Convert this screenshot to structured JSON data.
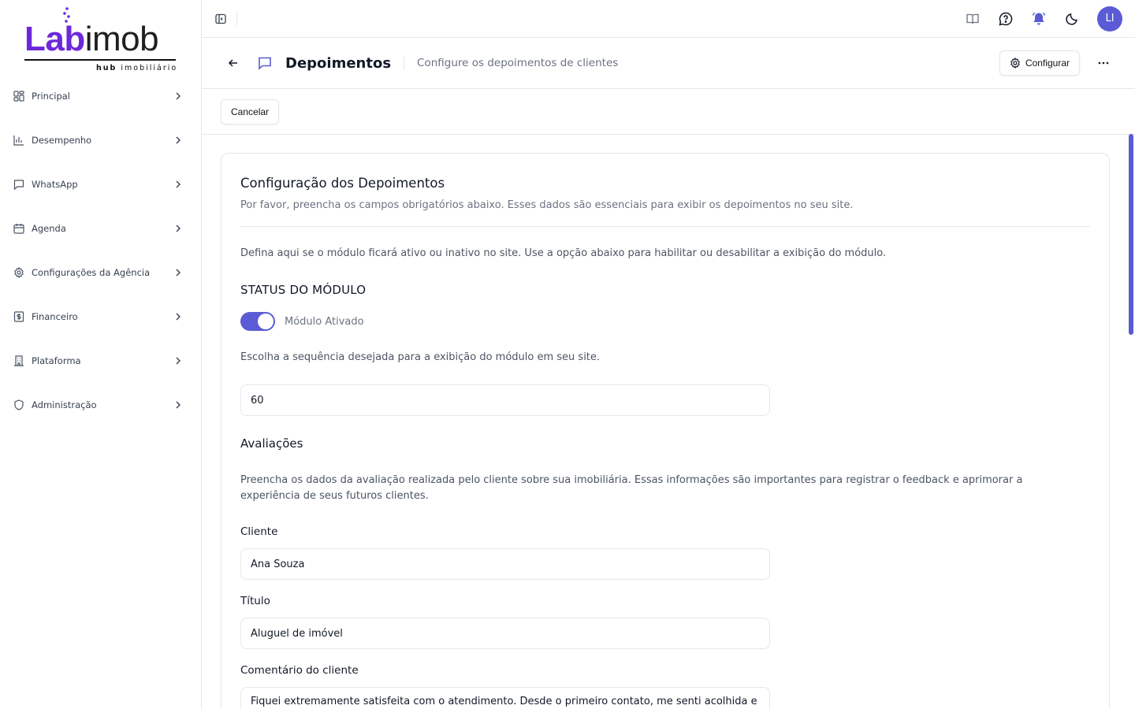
{
  "brand": {
    "logo_main_a": "Lab",
    "logo_main_b": "imob",
    "logo_sub_bold": "hub",
    "logo_sub": "imobiliário",
    "accent": "#5b5bd6"
  },
  "sidebar": {
    "items": [
      {
        "label": "Principal",
        "icon": "dashboard-icon"
      },
      {
        "label": "Desempenho",
        "icon": "bar-chart-icon"
      },
      {
        "label": "WhatsApp",
        "icon": "chat-icon"
      },
      {
        "label": "Agenda",
        "icon": "calendar-icon"
      },
      {
        "label": "Configurações da Agência",
        "icon": "gear-icon"
      },
      {
        "label": "Financeiro",
        "icon": "dollar-icon"
      },
      {
        "label": "Plataforma",
        "icon": "building-icon"
      },
      {
        "label": "Administração",
        "icon": "shield-icon"
      }
    ]
  },
  "topbar": {
    "avatar_initials": "LI"
  },
  "header": {
    "title": "Depoimentos",
    "subtitle": "Configure os depoimentos de clientes",
    "configure_label": "Configurar"
  },
  "actions": {
    "cancel_label": "Cancelar"
  },
  "form": {
    "title": "Configuração dos Depoimentos",
    "description": "Por favor, preencha os campos obrigatórios abaixo. Esses dados são essenciais para exibir os depoimentos no seu site.",
    "module_help": "Defina aqui se o módulo ficará ativo ou inativo no site. Use a opção abaixo para habilitar ou desabilitar a exibição do módulo.",
    "status_heading": "STATUS DO MÓDULO",
    "toggle_label": "Módulo Ativado",
    "toggle_on": true,
    "order_help": "Escolha a sequência desejada para a exibição do módulo em seu site.",
    "order_value": "60",
    "reviews_heading": "Avaliações",
    "reviews_help_line1": "Preencha os dados da avaliação realizada pelo cliente sobre sua imobiliária. Essas informações são importantes para registrar o feedback e aprimorar a",
    "reviews_help_line2": "experiência de seus futuros clientes.",
    "client_label": "Cliente",
    "client_value": "Ana Souza",
    "title_label": "Título",
    "title_value": "Aluguel de imóvel",
    "comment_label": "Comentário do cliente",
    "comment_value": "Fiquei extremamente satisfeita com o atendimento. Desde o primeiro contato, me senti acolhida e"
  }
}
